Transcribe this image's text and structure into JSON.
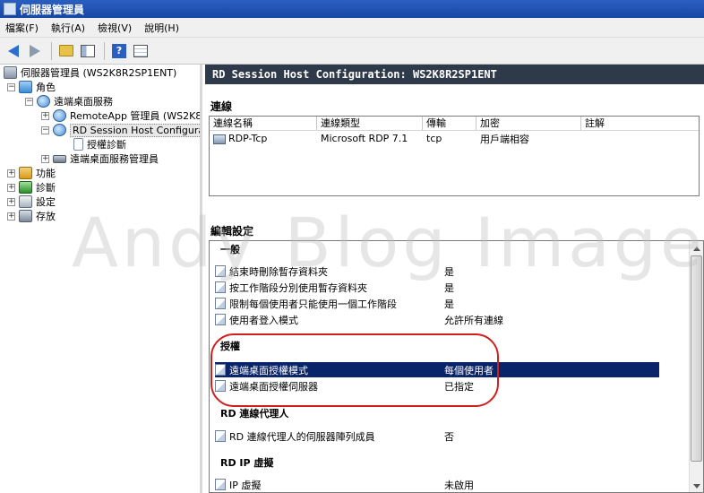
{
  "window": {
    "title": "伺服器管理員"
  },
  "menu": [
    "檔案(F)",
    "執行(A)",
    "檢視(V)",
    "說明(H)"
  ],
  "toolbar": {
    "back_icon": "back-arrow-icon",
    "forward_icon": "forward-arrow-icon",
    "help_label": "?"
  },
  "tree": {
    "root": "伺服器管理員 (WS2K8R2SP1ENT)",
    "roles": "角色",
    "rds": "遠端桌面服務",
    "remoteapp": "RemoteApp 管理員 (WS2K8",
    "rdsh": "RD Session Host Configuratio",
    "licensing_diag": "授權診斷",
    "rds_manager": "遠端桌面服務管理員",
    "features": "功能",
    "diagnostics": "診斷",
    "configuration": "設定",
    "storage": "存放"
  },
  "main": {
    "header": "RD Session Host Configuration: WS2K8R2SP1ENT",
    "connections_title": "連線",
    "columns": [
      "連線名稱",
      "連線類型",
      "傳輸",
      "加密",
      "註解"
    ],
    "rows": [
      [
        "RDP-Tcp",
        "Microsoft RDP 7.1",
        "tcp",
        "用戶端相容",
        ""
      ]
    ],
    "edit_title": "編輯設定",
    "groups": {
      "general": "一般",
      "licensing": "授權",
      "broker": "RD 連線代理人",
      "ipvirt": "RD IP 虛擬"
    },
    "settings": {
      "general": [
        {
          "name": "結束時刪除暫存資料夾",
          "value": "是"
        },
        {
          "name": "按工作階段分別使用暫存資料夾",
          "value": "是"
        },
        {
          "name": "限制每個使用者只能使用一個工作階段",
          "value": "是"
        },
        {
          "name": "使用者登入模式",
          "value": "允許所有連線"
        }
      ],
      "licensing": [
        {
          "name": "遠端桌面授權模式",
          "value": "每個使用者"
        },
        {
          "name": "遠端桌面授權伺服器",
          "value": "已指定"
        }
      ],
      "broker": [
        {
          "name": "RD 連線代理人的伺服器陣列成員",
          "value": "否"
        }
      ],
      "ipvirt": [
        {
          "name": "IP 虛擬",
          "value": "未啟用"
        }
      ]
    }
  },
  "watermark": "Andy Blog Image",
  "colors": {
    "title_bar": "#1f52b4",
    "header_bar": "#2e3a4a",
    "selection": "#0a246a",
    "annotation": "#d0201e"
  }
}
